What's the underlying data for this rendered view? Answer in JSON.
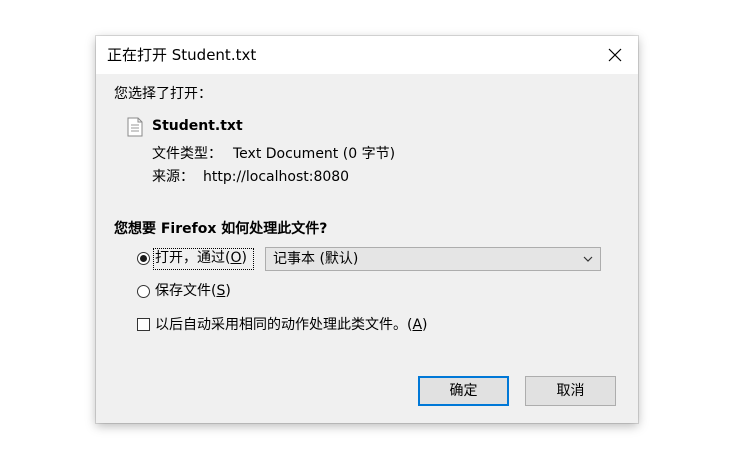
{
  "dialog": {
    "title": "正在打开 Student.txt",
    "intro": "您选择了打开：",
    "file": {
      "name": "Student.txt",
      "type_label": "文件类型：",
      "type_value": "Text Document (0 字节)",
      "source_label": "来源：",
      "source_value": "http://localhost:8080"
    },
    "question": "您想要 Firefox 如何处理此文件?",
    "open_with": {
      "label": "打开，通过(",
      "accesskey": "O",
      "label_end": ")",
      "selected": true,
      "app_selected": "记事本 (默认)"
    },
    "save_file": {
      "label": "保存文件(",
      "accesskey": "S",
      "label_end": ")",
      "selected": false
    },
    "remember": {
      "label": "以后自动采用相同的动作处理此类文件。(",
      "accesskey": "A",
      "label_end": ")",
      "checked": false
    },
    "buttons": {
      "ok": "确定",
      "cancel": "取消"
    },
    "icons": {
      "close": "close-icon",
      "file": "text-file-icon",
      "dropdown": "chevron-down-icon"
    },
    "colors": {
      "primary_border": "#0078d7",
      "dialog_bg": "#f0f0f0"
    }
  }
}
